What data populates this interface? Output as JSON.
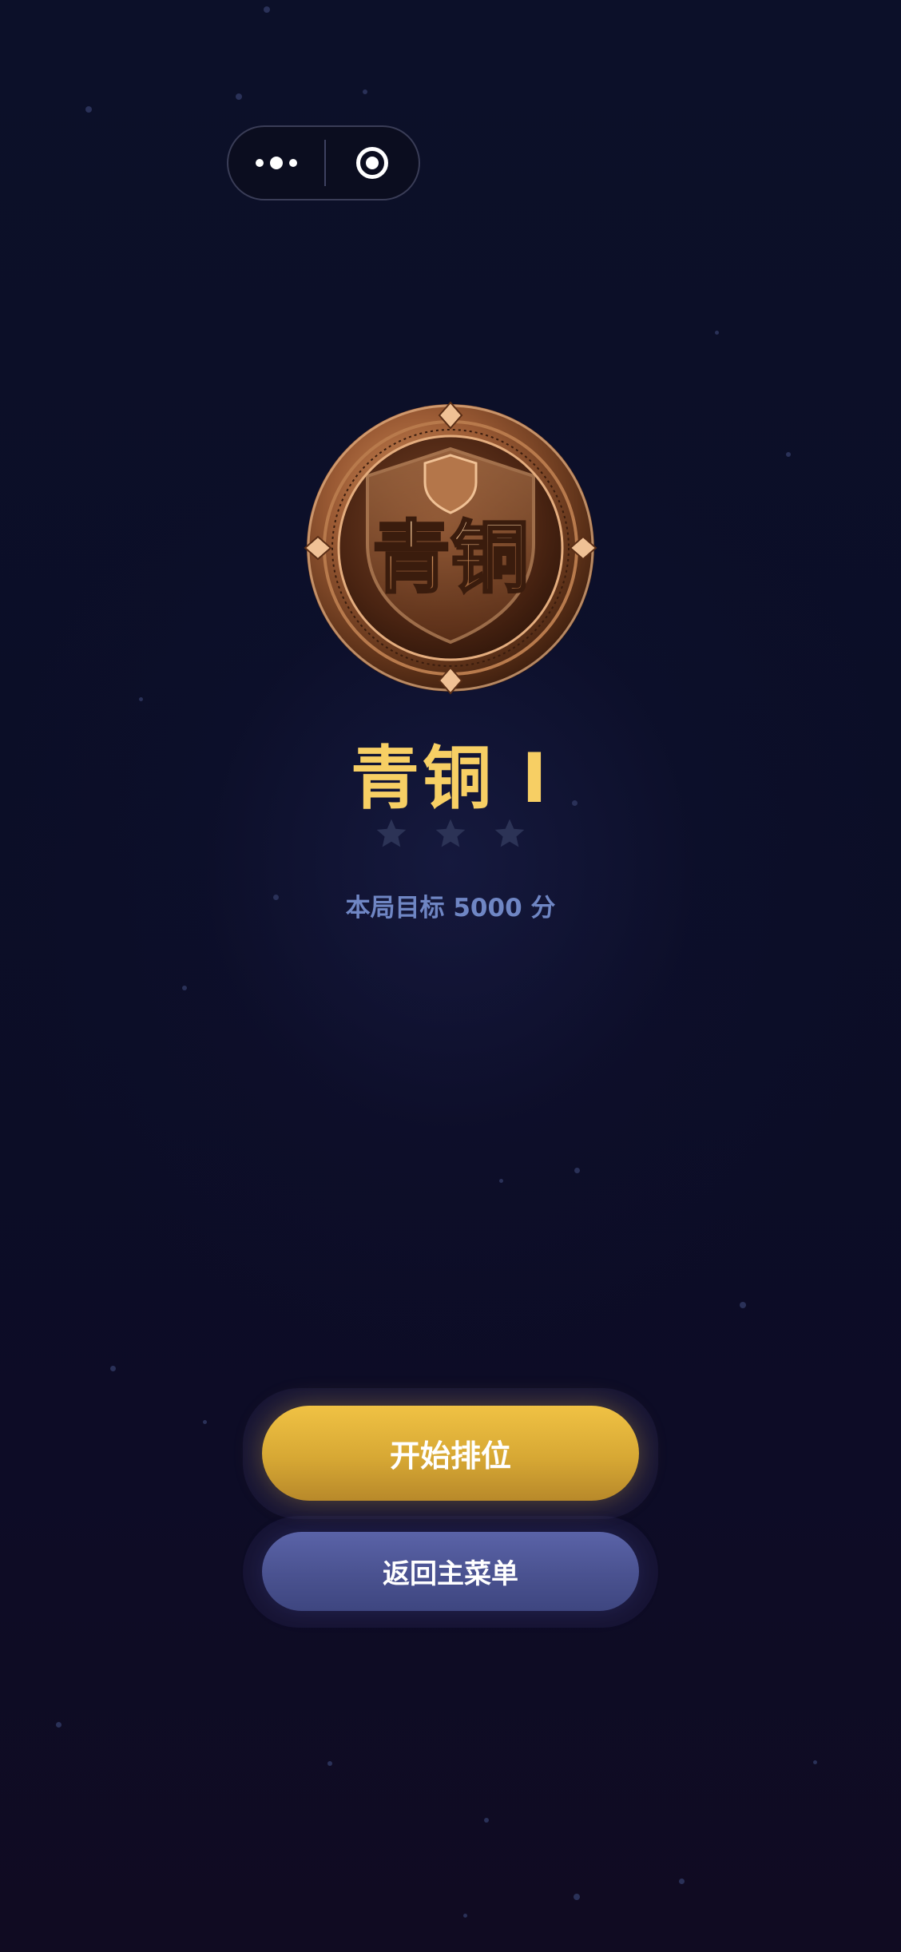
{
  "capsule": {
    "more_icon": "more-dots-icon",
    "close_icon": "target-ring-icon"
  },
  "rank": {
    "medal_text": "青铜",
    "title": "青铜 I",
    "stars_total": 3,
    "stars_filled": 0,
    "target_text": "本局目标 5000 分"
  },
  "buttons": {
    "start_label": "开始排位",
    "back_label": "返回主菜单"
  },
  "colors": {
    "title": "#f7cf64",
    "target_text": "#6f86c4",
    "start_button": "#e2b43c",
    "back_button": "#4e5694",
    "background": "#0c1029"
  }
}
